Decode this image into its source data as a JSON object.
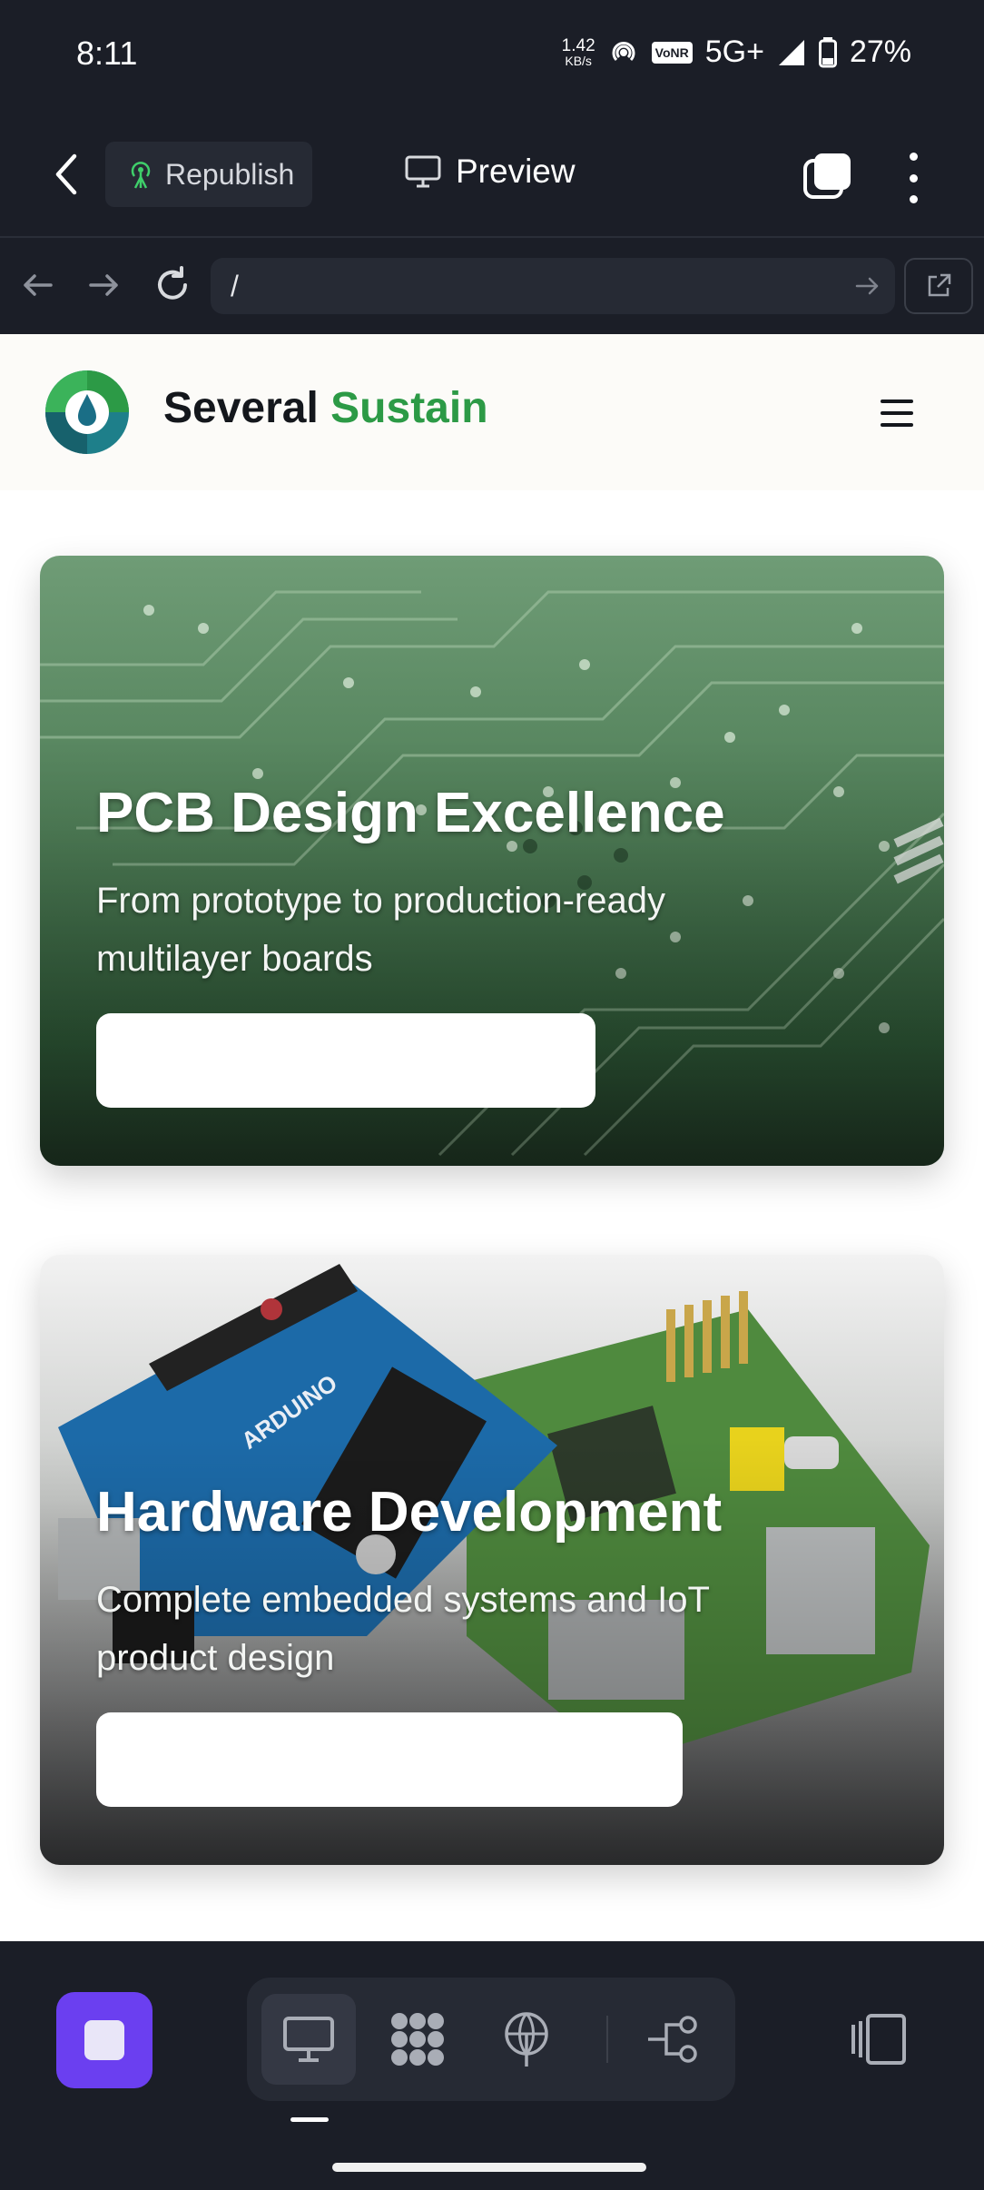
{
  "status_bar": {
    "time": "8:11",
    "net_speed": "1.42",
    "net_unit": "KB/s",
    "vonr": "VoNR",
    "network": "5G+",
    "battery": "27%"
  },
  "toolbar": {
    "republish_label": "Republish",
    "preview_label": "Preview"
  },
  "browser": {
    "url": "/"
  },
  "site": {
    "brand_main": "Several",
    "brand_accent": "Sustain",
    "accent_color": "#2c9a46"
  },
  "cards": [
    {
      "title": "PCB Design Excellence",
      "subtitle": "From prototype to production-ready multilayer boards"
    },
    {
      "title": "Hardware Development",
      "subtitle": "Complete embedded systems and IoT product design"
    }
  ],
  "colors": {
    "app_bg": "#1b1e27",
    "stop_button": "#6b3ff0"
  }
}
